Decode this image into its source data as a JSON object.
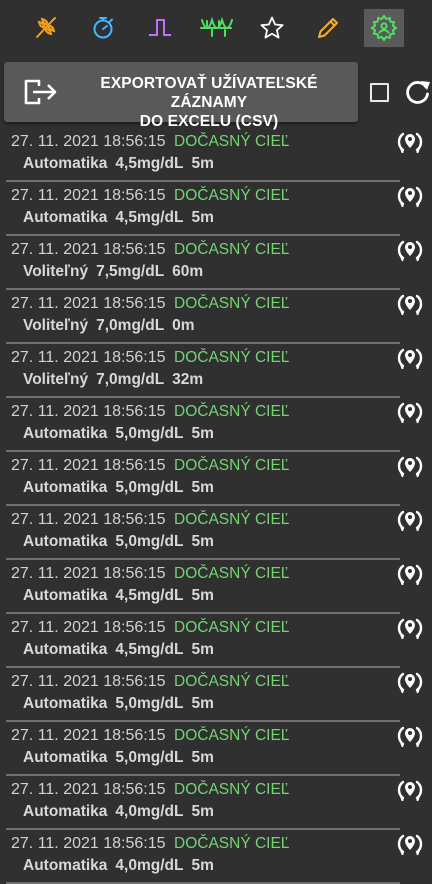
{
  "toolbar": {
    "buttons": [
      {
        "icon": "wheat-icon",
        "color": "#f0a020"
      },
      {
        "icon": "stopwatch-icon",
        "color": "#40b8ff"
      },
      {
        "icon": "pulse-icon",
        "color": "#c070ff"
      },
      {
        "icon": "cgm-wave-icon",
        "color": "#50e060"
      },
      {
        "icon": "star-icon",
        "color": "#ffffff"
      },
      {
        "icon": "pencil-icon",
        "color": "#f0b030"
      },
      {
        "icon": "settings-user-icon",
        "color": "#50e060",
        "active": true
      }
    ]
  },
  "export": {
    "label_line1": "EXPORTOVAŤ UŽÍVATEĽSKÉ ZÁZNAMY",
    "label_line2": "DO EXCELU (CSV)"
  },
  "entries": [
    {
      "date": "27. 11. 2021 18:56:15",
      "type": "DOČASNÝ CIEĽ",
      "reason": "Automatika",
      "value": "4,5mg/dL",
      "duration": "5m"
    },
    {
      "date": "27. 11. 2021 18:56:15",
      "type": "DOČASNÝ CIEĽ",
      "reason": "Automatika",
      "value": "4,5mg/dL",
      "duration": "5m"
    },
    {
      "date": "27. 11. 2021 18:56:15",
      "type": "DOČASNÝ CIEĽ",
      "reason": "Voliteľný",
      "value": "7,5mg/dL",
      "duration": "60m"
    },
    {
      "date": "27. 11. 2021 18:56:15",
      "type": "DOČASNÝ CIEĽ",
      "reason": "Voliteľný",
      "value": "7,0mg/dL",
      "duration": "0m"
    },
    {
      "date": "27. 11. 2021 18:56:15",
      "type": "DOČASNÝ CIEĽ",
      "reason": "Voliteľný",
      "value": "7,0mg/dL",
      "duration": "32m"
    },
    {
      "date": "27. 11. 2021 18:56:15",
      "type": "DOČASNÝ CIEĽ",
      "reason": "Automatika",
      "value": "5,0mg/dL",
      "duration": "5m"
    },
    {
      "date": "27. 11. 2021 18:56:15",
      "type": "DOČASNÝ CIEĽ",
      "reason": "Automatika",
      "value": "5,0mg/dL",
      "duration": "5m"
    },
    {
      "date": "27. 11. 2021 18:56:15",
      "type": "DOČASNÝ CIEĽ",
      "reason": "Automatika",
      "value": "5,0mg/dL",
      "duration": "5m"
    },
    {
      "date": "27. 11. 2021 18:56:15",
      "type": "DOČASNÝ CIEĽ",
      "reason": "Automatika",
      "value": "4,5mg/dL",
      "duration": "5m"
    },
    {
      "date": "27. 11. 2021 18:56:15",
      "type": "DOČASNÝ CIEĽ",
      "reason": "Automatika",
      "value": "4,5mg/dL",
      "duration": "5m"
    },
    {
      "date": "27. 11. 2021 18:56:15",
      "type": "DOČASNÝ CIEĽ",
      "reason": "Automatika",
      "value": "5,0mg/dL",
      "duration": "5m"
    },
    {
      "date": "27. 11. 2021 18:56:15",
      "type": "DOČASNÝ CIEĽ",
      "reason": "Automatika",
      "value": "5,0mg/dL",
      "duration": "5m"
    },
    {
      "date": "27. 11. 2021 18:56:15",
      "type": "DOČASNÝ CIEĽ",
      "reason": "Automatika",
      "value": "4,0mg/dL",
      "duration": "5m"
    },
    {
      "date": "27. 11. 2021 18:56:15",
      "type": "DOČASNÝ CIEĽ",
      "reason": "Automatika",
      "value": "4,0mg/dL",
      "duration": "5m"
    }
  ]
}
